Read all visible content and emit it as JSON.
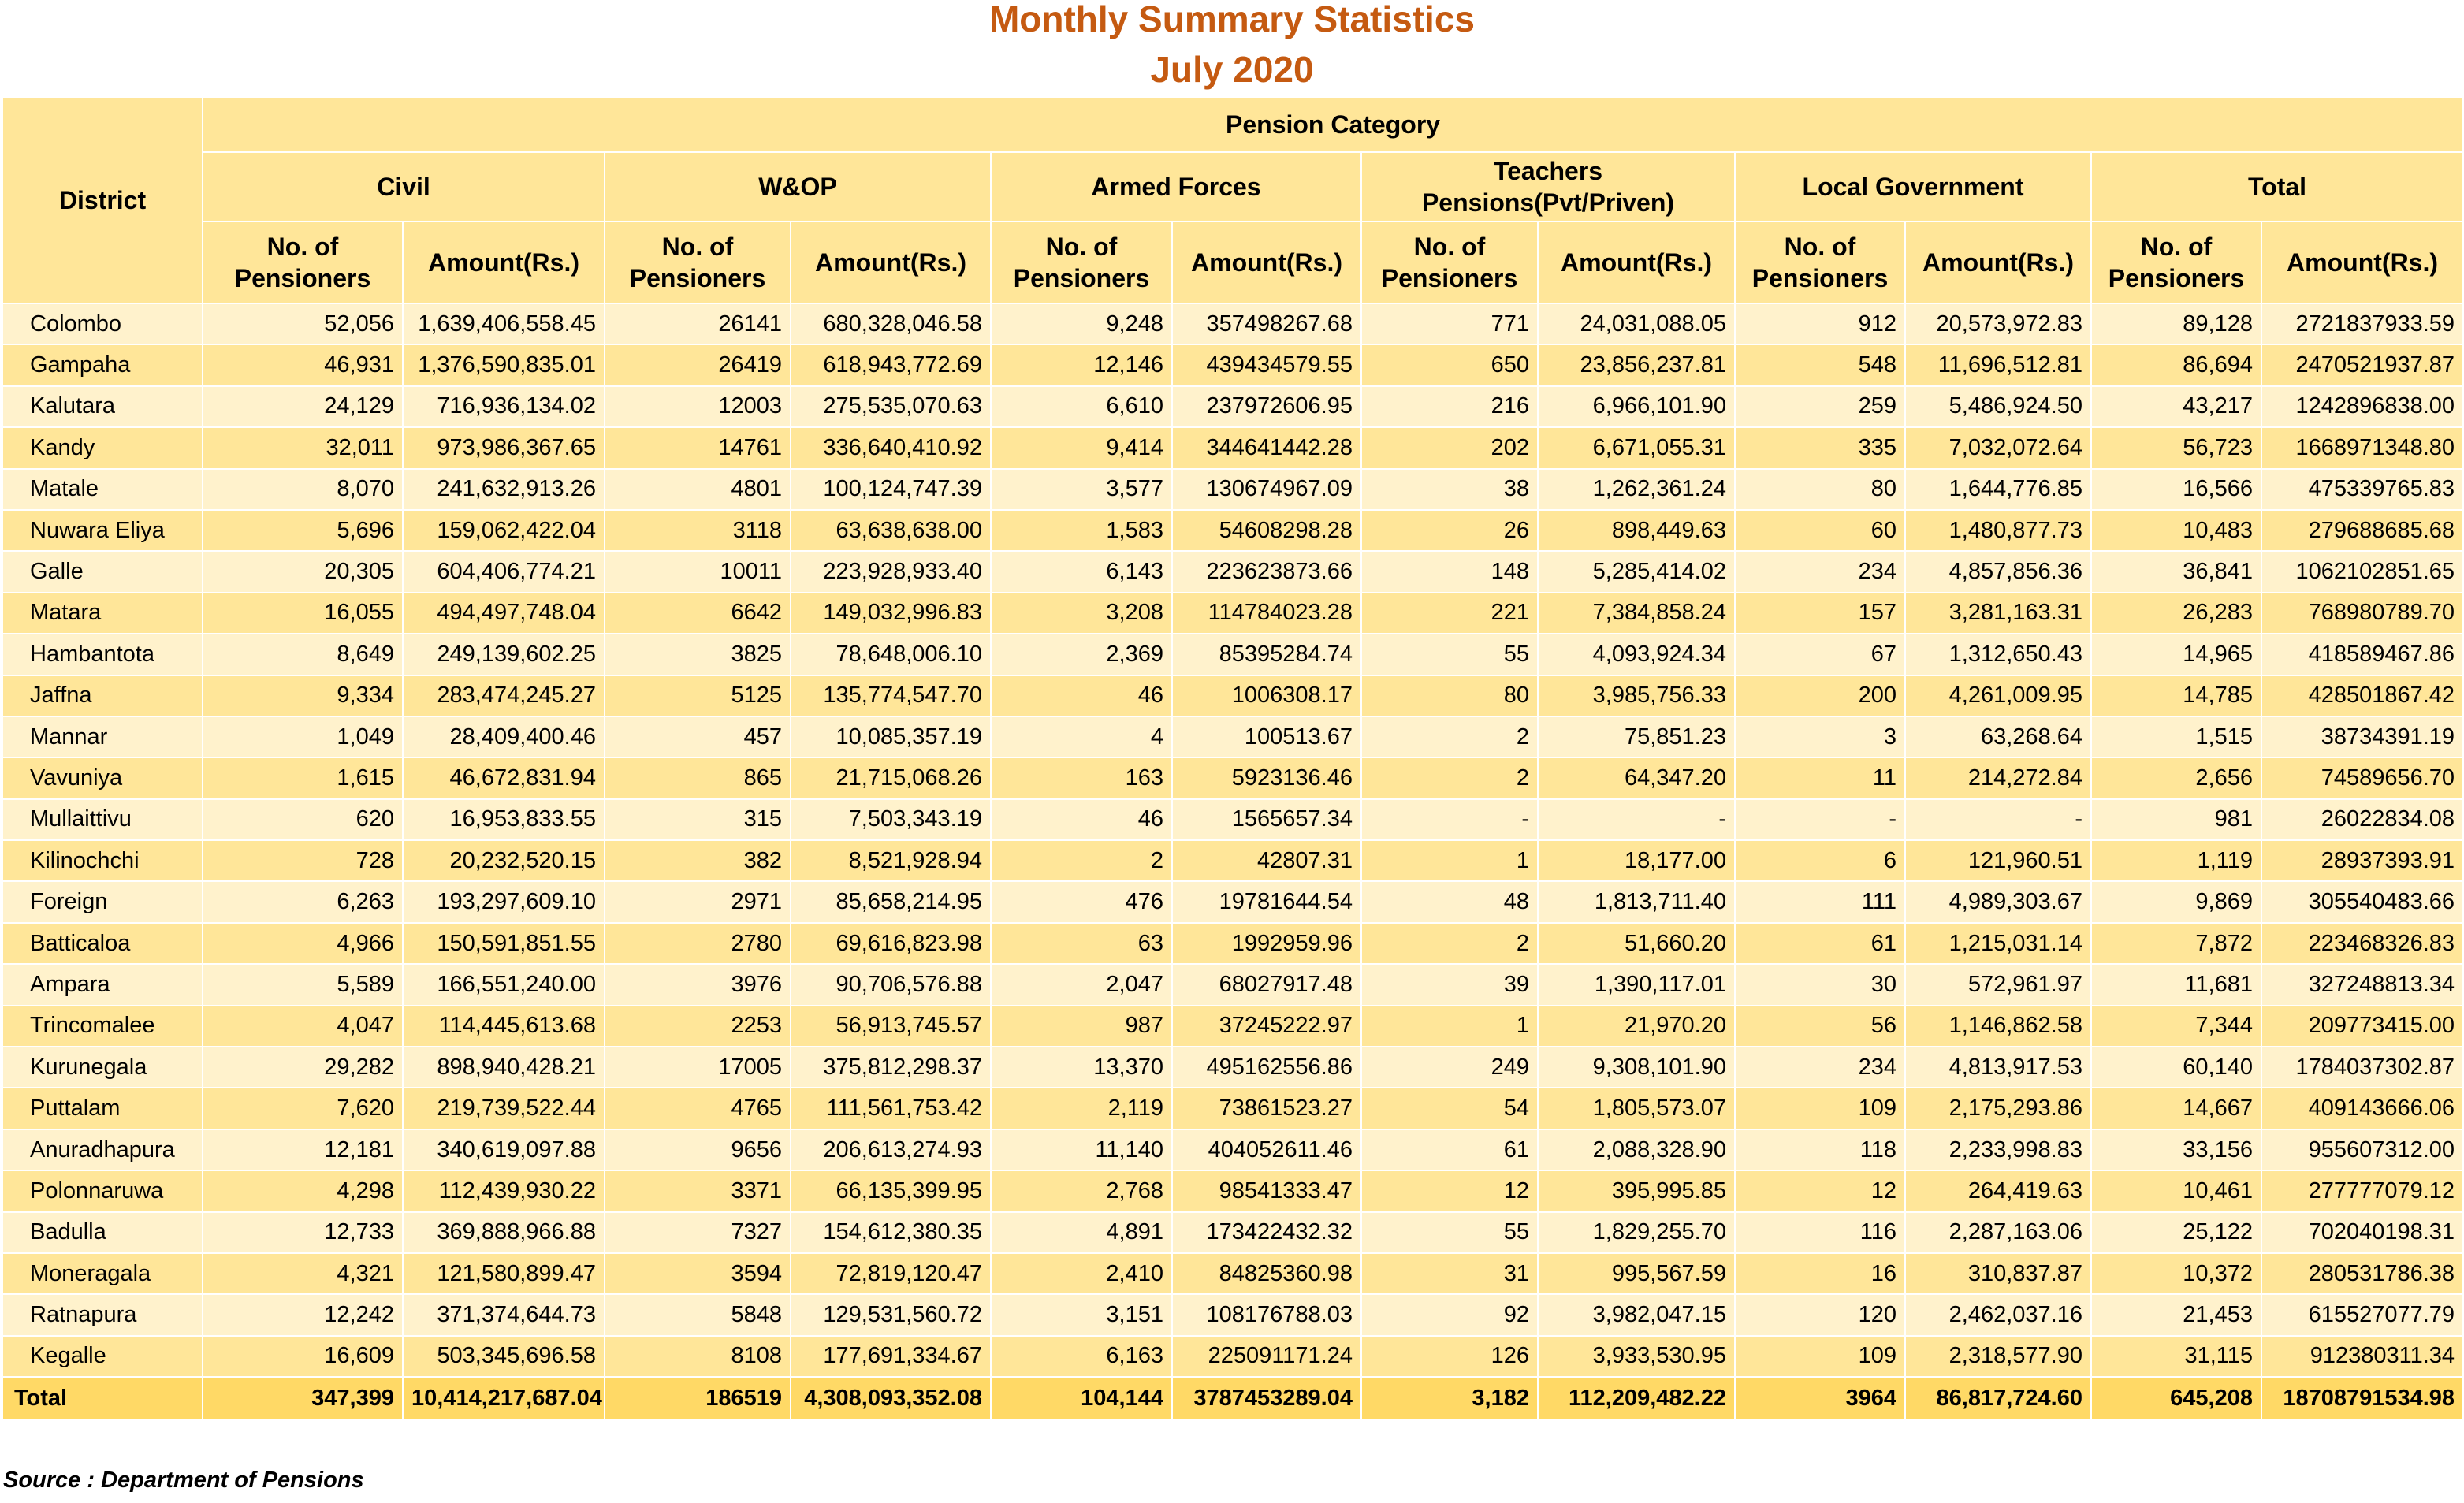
{
  "title": "Monthly Summary  Statistics",
  "subtitle": "July 2020",
  "header": {
    "district": "District",
    "pension_category": "Pension Category",
    "categories": [
      "Civil",
      "W&OP",
      "Armed Forces",
      "Teachers Pensions(Pvt/Priven)",
      "Local Government",
      "Total"
    ],
    "col_pensioners": "No. of Pensioners",
    "col_amount": "Amount(Rs.)"
  },
  "rows": [
    [
      "Colombo",
      "52,056",
      "1,639,406,558.45",
      "26141",
      "680,328,046.58",
      "9,248",
      "357498267.68",
      "771",
      "24,031,088.05",
      "912",
      "20,573,972.83",
      "89,128",
      "2721837933.59"
    ],
    [
      "Gampaha",
      "46,931",
      "1,376,590,835.01",
      "26419",
      "618,943,772.69",
      "12,146",
      "439434579.55",
      "650",
      "23,856,237.81",
      "548",
      "11,696,512.81",
      "86,694",
      "2470521937.87"
    ],
    [
      "Kalutara",
      "24,129",
      "716,936,134.02",
      "12003",
      "275,535,070.63",
      "6,610",
      "237972606.95",
      "216",
      "6,966,101.90",
      "259",
      "5,486,924.50",
      "43,217",
      "1242896838.00"
    ],
    [
      "Kandy",
      "32,011",
      "973,986,367.65",
      "14761",
      "336,640,410.92",
      "9,414",
      "344641442.28",
      "202",
      "6,671,055.31",
      "335",
      "7,032,072.64",
      "56,723",
      "1668971348.80"
    ],
    [
      "Matale",
      "8,070",
      "241,632,913.26",
      "4801",
      "100,124,747.39",
      "3,577",
      "130674967.09",
      "38",
      "1,262,361.24",
      "80",
      "1,644,776.85",
      "16,566",
      "475339765.83"
    ],
    [
      "Nuwara Eliya",
      "5,696",
      "159,062,422.04",
      "3118",
      "63,638,638.00",
      "1,583",
      "54608298.28",
      "26",
      "898,449.63",
      "60",
      "1,480,877.73",
      "10,483",
      "279688685.68"
    ],
    [
      "Galle",
      "20,305",
      "604,406,774.21",
      "10011",
      "223,928,933.40",
      "6,143",
      "223623873.66",
      "148",
      "5,285,414.02",
      "234",
      "4,857,856.36",
      "36,841",
      "1062102851.65"
    ],
    [
      "Matara",
      "16,055",
      "494,497,748.04",
      "6642",
      "149,032,996.83",
      "3,208",
      "114784023.28",
      "221",
      "7,384,858.24",
      "157",
      "3,281,163.31",
      "26,283",
      "768980789.70"
    ],
    [
      "Hambantota",
      "8,649",
      "249,139,602.25",
      "3825",
      "78,648,006.10",
      "2,369",
      "85395284.74",
      "55",
      "4,093,924.34",
      "67",
      "1,312,650.43",
      "14,965",
      "418589467.86"
    ],
    [
      "Jaffna",
      "9,334",
      "283,474,245.27",
      "5125",
      "135,774,547.70",
      "46",
      "1006308.17",
      "80",
      "3,985,756.33",
      "200",
      "4,261,009.95",
      "14,785",
      "428501867.42"
    ],
    [
      "Mannar",
      "1,049",
      "28,409,400.46",
      "457",
      "10,085,357.19",
      "4",
      "100513.67",
      "2",
      "75,851.23",
      "3",
      "63,268.64",
      "1,515",
      "38734391.19"
    ],
    [
      "Vavuniya",
      "1,615",
      "46,672,831.94",
      "865",
      "21,715,068.26",
      "163",
      "5923136.46",
      "2",
      "64,347.20",
      "11",
      "214,272.84",
      "2,656",
      "74589656.70"
    ],
    [
      "Mullaittivu",
      "620",
      "16,953,833.55",
      "315",
      "7,503,343.19",
      "46",
      "1565657.34",
      "-",
      "-",
      "-",
      "-",
      "981",
      "26022834.08"
    ],
    [
      "Kilinochchi",
      "728",
      "20,232,520.15",
      "382",
      "8,521,928.94",
      "2",
      "42807.31",
      "1",
      "18,177.00",
      "6",
      "121,960.51",
      "1,119",
      "28937393.91"
    ],
    [
      "Foreign",
      "6,263",
      "193,297,609.10",
      "2971",
      "85,658,214.95",
      "476",
      "19781644.54",
      "48",
      "1,813,711.40",
      "111",
      "4,989,303.67",
      "9,869",
      "305540483.66"
    ],
    [
      "Batticaloa",
      "4,966",
      "150,591,851.55",
      "2780",
      "69,616,823.98",
      "63",
      "1992959.96",
      "2",
      "51,660.20",
      "61",
      "1,215,031.14",
      "7,872",
      "223468326.83"
    ],
    [
      "Ampara",
      "5,589",
      "166,551,240.00",
      "3976",
      "90,706,576.88",
      "2,047",
      "68027917.48",
      "39",
      "1,390,117.01",
      "30",
      "572,961.97",
      "11,681",
      "327248813.34"
    ],
    [
      "Trincomalee",
      "4,047",
      "114,445,613.68",
      "2253",
      "56,913,745.57",
      "987",
      "37245222.97",
      "1",
      "21,970.20",
      "56",
      "1,146,862.58",
      "7,344",
      "209773415.00"
    ],
    [
      "Kurunegala",
      "29,282",
      "898,940,428.21",
      "17005",
      "375,812,298.37",
      "13,370",
      "495162556.86",
      "249",
      "9,308,101.90",
      "234",
      "4,813,917.53",
      "60,140",
      "1784037302.87"
    ],
    [
      "Puttalam",
      "7,620",
      "219,739,522.44",
      "4765",
      "111,561,753.42",
      "2,119",
      "73861523.27",
      "54",
      "1,805,573.07",
      "109",
      "2,175,293.86",
      "14,667",
      "409143666.06"
    ],
    [
      "Anuradhapura",
      "12,181",
      "340,619,097.88",
      "9656",
      "206,613,274.93",
      "11,140",
      "404052611.46",
      "61",
      "2,088,328.90",
      "118",
      "2,233,998.83",
      "33,156",
      "955607312.00"
    ],
    [
      "Polonnaruwa",
      "4,298",
      "112,439,930.22",
      "3371",
      "66,135,399.95",
      "2,768",
      "98541333.47",
      "12",
      "395,995.85",
      "12",
      "264,419.63",
      "10,461",
      "277777079.12"
    ],
    [
      "Badulla",
      "12,733",
      "369,888,966.88",
      "7327",
      "154,612,380.35",
      "4,891",
      "173422432.32",
      "55",
      "1,829,255.70",
      "116",
      "2,287,163.06",
      "25,122",
      "702040198.31"
    ],
    [
      "Moneragala",
      "4,321",
      "121,580,899.47",
      "3594",
      "72,819,120.47",
      "2,410",
      "84825360.98",
      "31",
      "995,567.59",
      "16",
      "310,837.87",
      "10,372",
      "280531786.38"
    ],
    [
      "Ratnapura",
      "12,242",
      "371,374,644.73",
      "5848",
      "129,531,560.72",
      "3,151",
      "108176788.03",
      "92",
      "3,982,047.15",
      "120",
      "2,462,037.16",
      "21,453",
      "615527077.79"
    ],
    [
      "Kegalle",
      "16,609",
      "503,345,696.58",
      "8108",
      "177,691,334.67",
      "6,163",
      "225091171.24",
      "126",
      "3,933,530.95",
      "109",
      "2,318,577.90",
      "31,115",
      "912380311.34"
    ]
  ],
  "total": [
    "Total",
    "347,399",
    "10,414,217,687.04",
    "186519",
    "4,308,093,352.08",
    "104,144",
    "3787453289.04",
    "3,182",
    "112,209,482.22",
    "3964",
    "86,817,724.60",
    "645,208",
    "18708791534.98"
  ],
  "source": "Source : Department of Pensions",
  "colors": {
    "title": "#c55a11",
    "header_bg": "#ffe699",
    "row_light": "#fff2cc",
    "row_dark": "#ffe699",
    "total_bg": "#ffd966"
  }
}
